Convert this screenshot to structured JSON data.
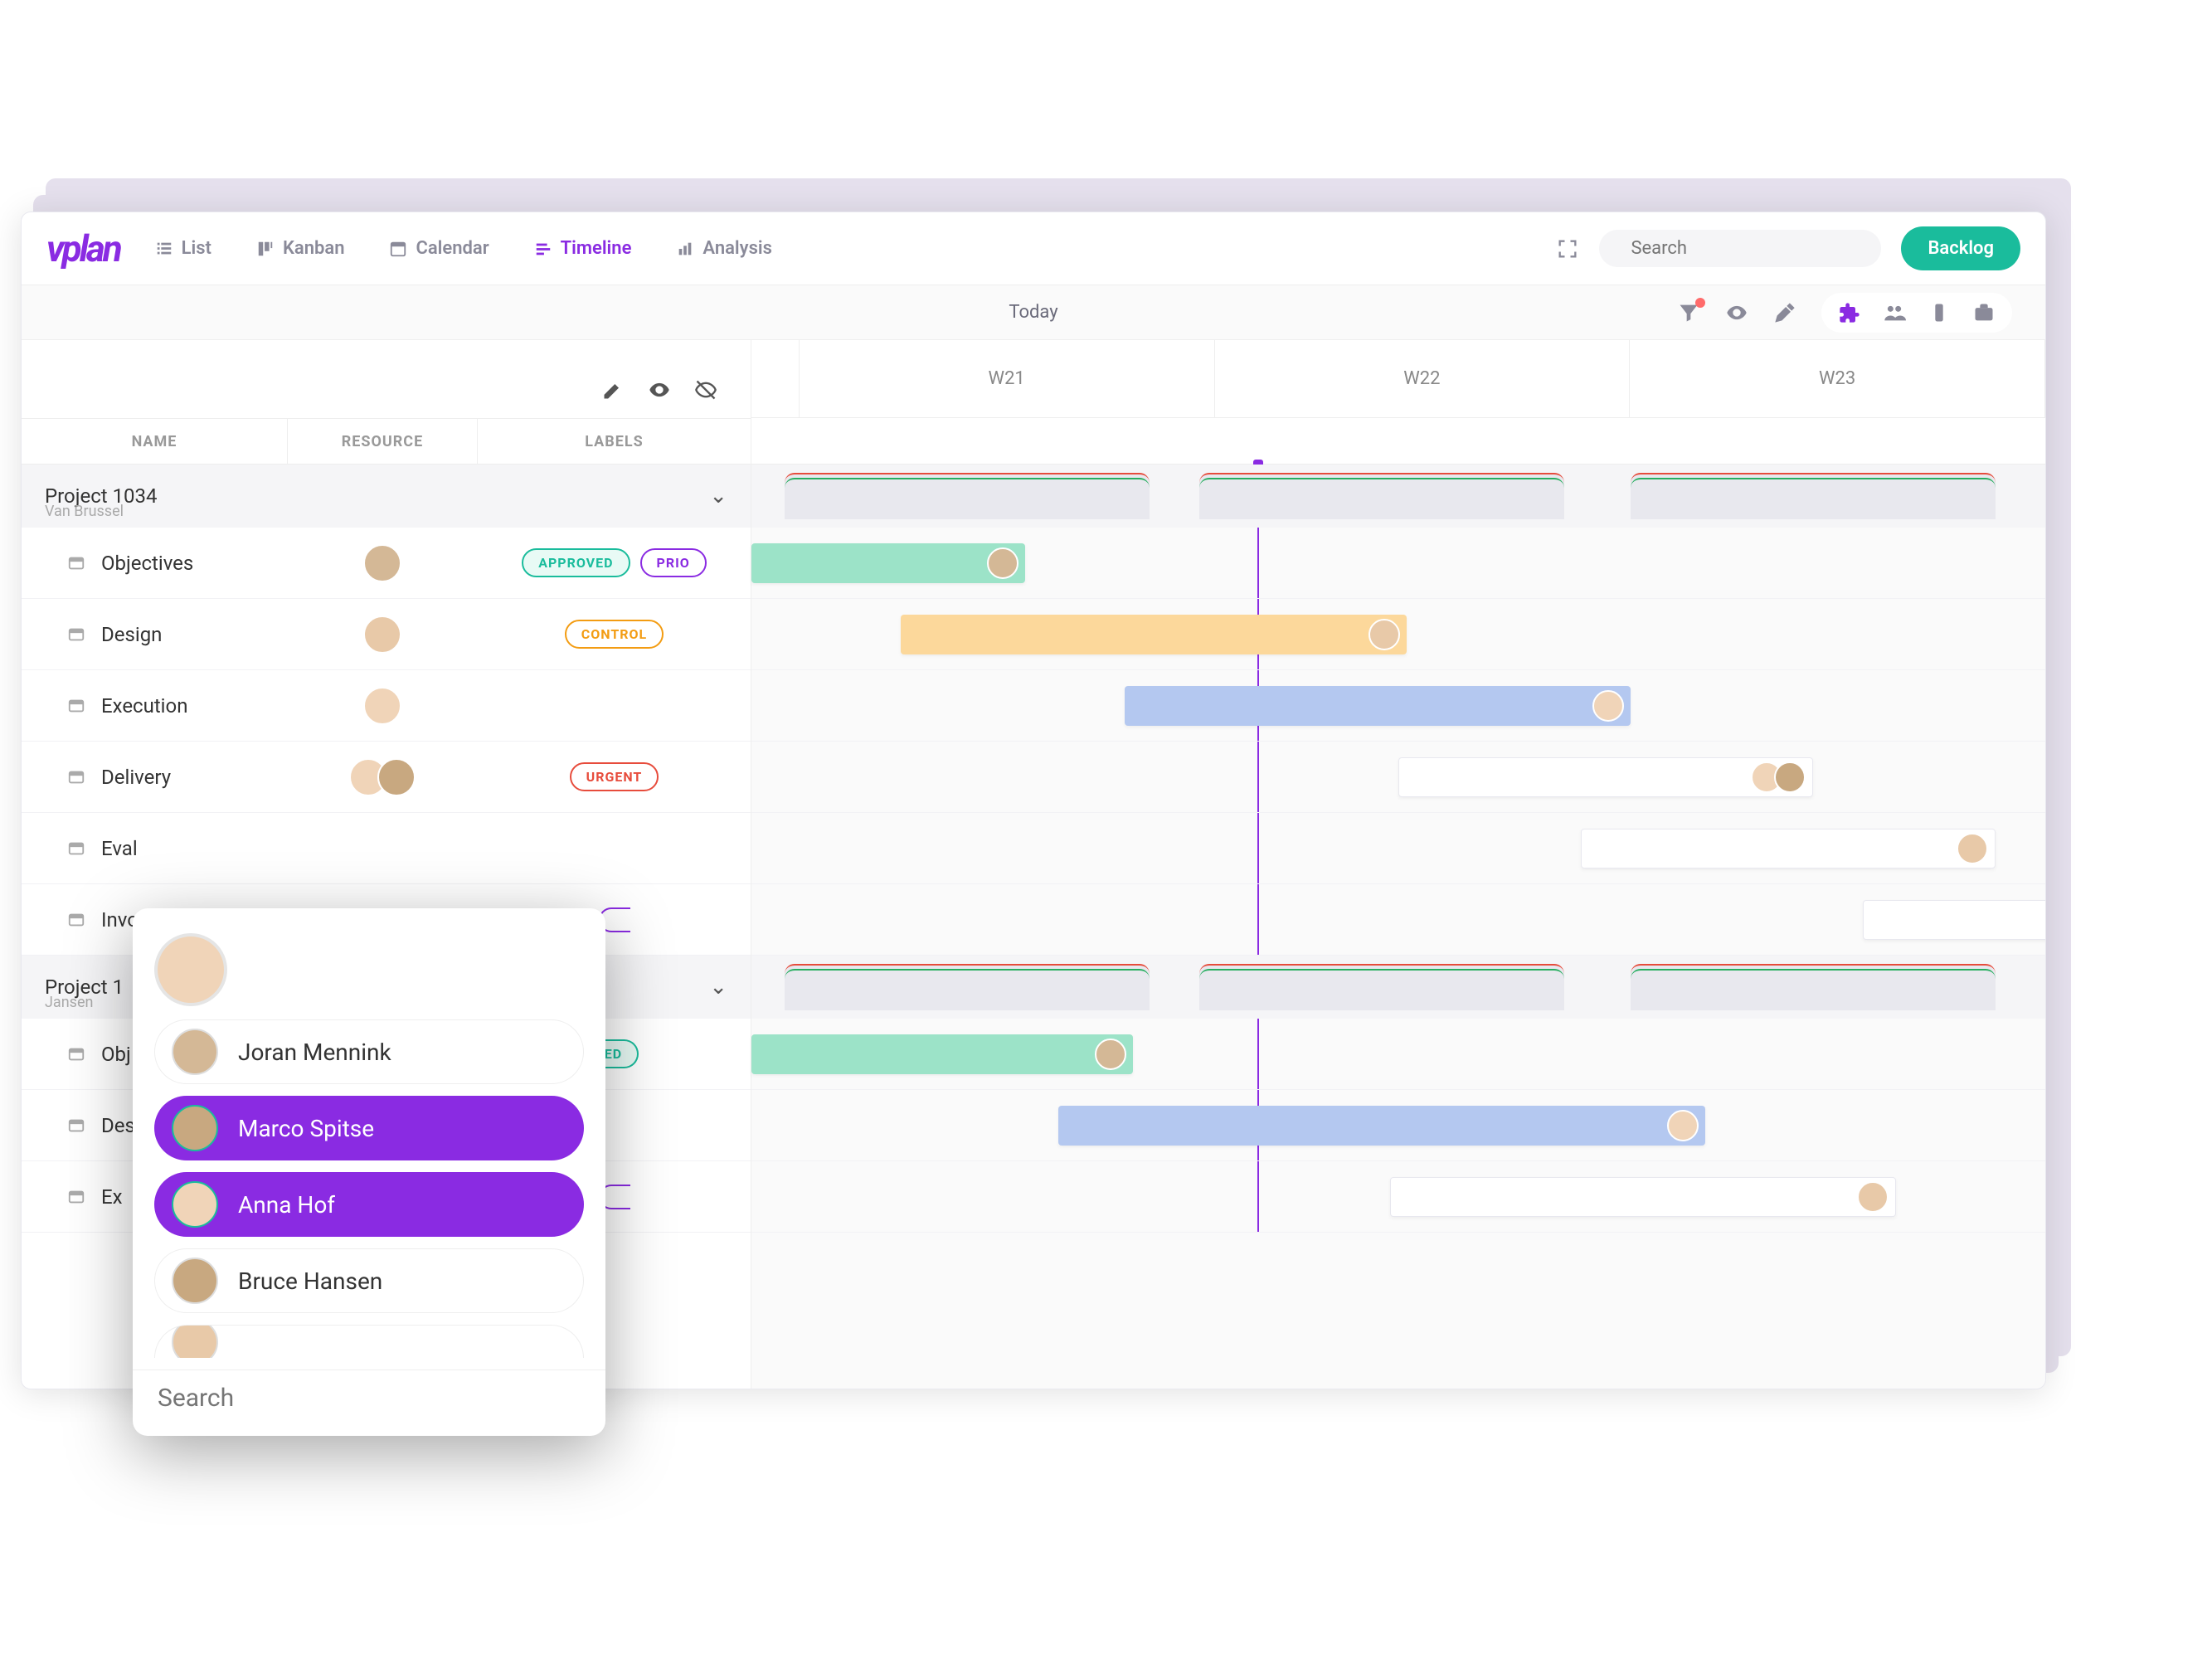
{
  "brand": "vplan",
  "nav": {
    "list": "List",
    "kanban": "Kanban",
    "calendar": "Calendar",
    "timeline": "Timeline",
    "analysis": "Analysis"
  },
  "search_placeholder": "Search",
  "backlog": "Backlog",
  "today": "Today",
  "columns": {
    "name": "NAME",
    "resource": "RESOURCE",
    "labels": "LABELS"
  },
  "weeks": [
    "W21",
    "W22",
    "W23"
  ],
  "groups": [
    {
      "title": "Project 1034",
      "subtitle": "Van Brussel",
      "tasks": [
        {
          "name": "Objectives",
          "labels": [
            {
              "text": "APPROVED",
              "variant": "green"
            },
            {
              "text": "PRIO",
              "variant": "purple"
            }
          ]
        },
        {
          "name": "Design",
          "labels": [
            {
              "text": "CONTROL",
              "variant": "orange"
            }
          ]
        },
        {
          "name": "Execution",
          "labels": []
        },
        {
          "name": "Delivery",
          "labels": [
            {
              "text": "URGENT",
              "variant": "red"
            }
          ]
        },
        {
          "name": "Eval",
          "labels": []
        },
        {
          "name": "Invo",
          "labels": [
            {
              "text": "",
              "variant": "purple"
            }
          ]
        }
      ]
    },
    {
      "title": "Project 1",
      "subtitle": "Jansen",
      "tasks": [
        {
          "name": "Obj",
          "labels": [
            {
              "text": "ED",
              "variant": "green"
            }
          ]
        },
        {
          "name": "Des",
          "labels": []
        },
        {
          "name": "Ex",
          "labels": [
            {
              "text": "",
              "variant": "purple"
            }
          ]
        }
      ]
    }
  ],
  "people": [
    {
      "name": "Joran Mennink",
      "selected": false
    },
    {
      "name": "Marco Spitse",
      "selected": true
    },
    {
      "name": "Anna Hof",
      "selected": true
    },
    {
      "name": "Bruce Hansen",
      "selected": false
    }
  ],
  "popover_search_placeholder": "Search",
  "avatars": {
    "a1": "#d4b896",
    "a2": "#e8c9a8",
    "a3": "#f0d4b8",
    "a4": "#c8a880"
  }
}
